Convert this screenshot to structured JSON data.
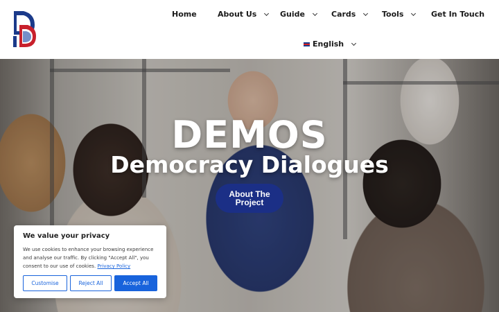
{
  "logo": {
    "letters": "DEMOS"
  },
  "nav": {
    "home": "Home",
    "about": "About Us",
    "guide": "Guide",
    "cards": "Cards",
    "tools": "Tools",
    "contact": "Get In Touch",
    "language": "English"
  },
  "hero": {
    "title": "DEMOS",
    "subtitle": "Democracy Dialogues",
    "button": "About The Project"
  },
  "cookie": {
    "title": "We value your privacy",
    "text": "We use cookies to enhance your browsing experience and analyse our traffic. By clicking \"Accept All\", you consent to our use of cookies.",
    "link": "Privacy Policy",
    "customise": "Customise",
    "reject": "Reject All",
    "accept": "Accept All"
  },
  "colors": {
    "brand_navy": "#1b2f86",
    "cookie_blue": "#1863dc",
    "logo_red": "#c8202c"
  }
}
